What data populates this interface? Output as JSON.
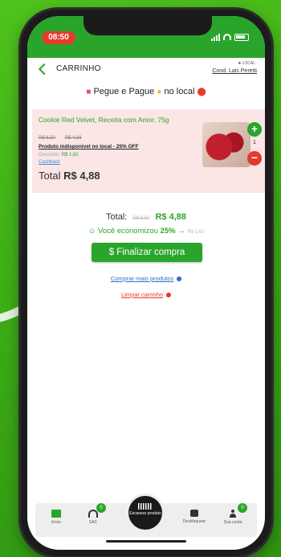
{
  "status_bar": {
    "time": "08:50"
  },
  "header": {
    "title": "CARRINHO",
    "location_label": "LOCAL",
    "location_value": "Cond. Lais Peretti"
  },
  "banner": {
    "text": "Pegue e Pague",
    "suffix": "no local",
    "icons": [
      "shopping-bag-icon",
      "smile-icon",
      "pin-icon"
    ]
  },
  "cart_item": {
    "name": "Cookie Red Velvet, Receita com Amor, 75g",
    "old_price": "R$ 6,50",
    "price": "R$ 4,88",
    "unavailable_text": "Produto indisponível no local - 25% OFF",
    "discount_label": "Desconto:",
    "discount_value": "R$ 1,62",
    "cashback_label": "Cashback",
    "total_label": "Total",
    "total_value": "R$ 4,88",
    "quantity": "1"
  },
  "summary": {
    "total_label": "Total:",
    "total_old": "R$ 6,50",
    "total_value": "R$ 4,88",
    "savings_prefix": "Você economizou",
    "savings_pct": "25%",
    "savings_arrow": "→",
    "savings_faint": "R$ 1,62"
  },
  "actions": {
    "finish_label": "$ Finalizar compra",
    "more_products": "Comprar mais produtos",
    "clear_cart": "Limpar carrinho"
  },
  "bottom_nav": {
    "items": [
      {
        "label": "Início",
        "icon": "home-icon"
      },
      {
        "label": "SAC",
        "icon": "headset-icon",
        "badge": "0"
      },
      {
        "label": "Escanear produto",
        "icon": "barcode-icon"
      },
      {
        "label": "Desbloquear",
        "icon": "lock-icon"
      },
      {
        "label": "Sua conta",
        "icon": "user-icon",
        "badge": "0"
      }
    ]
  },
  "colors": {
    "brand_green": "#2aa52c",
    "danger_red": "#e4392a",
    "item_bg": "#fbe5e5",
    "link_blue": "#2a6fc9"
  }
}
